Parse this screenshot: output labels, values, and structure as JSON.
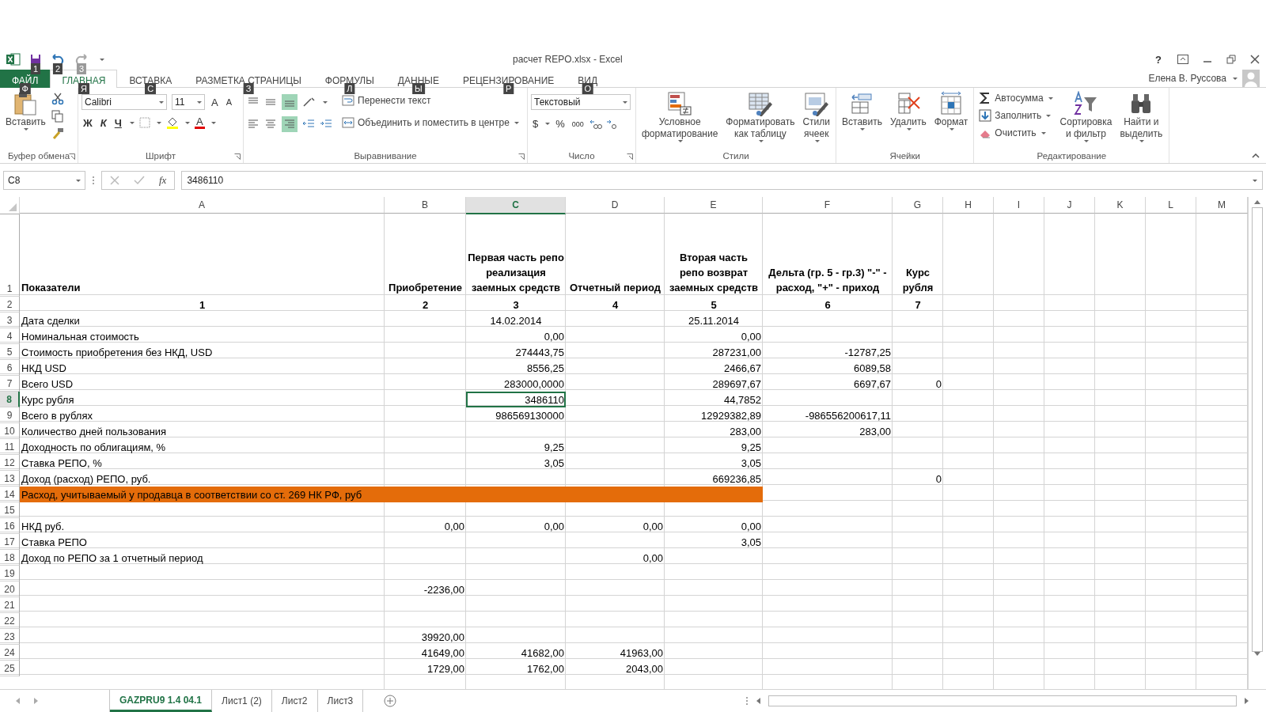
{
  "window": {
    "title": "расчет REPO.xlsx - Excel",
    "user": "Елена В. Руссова",
    "help": "?"
  },
  "quick_access": [
    {
      "kind": "save",
      "keytip": "1"
    },
    {
      "kind": "undo",
      "keytip": "2"
    },
    {
      "kind": "redo",
      "keytip": "3"
    }
  ],
  "tabs": [
    {
      "label": "ФАЙЛ",
      "selected": false,
      "kind": "file",
      "keytip": "Ф"
    },
    {
      "label": "ГЛАВНАЯ",
      "selected": true,
      "kind": "tab",
      "keytip": "Я"
    },
    {
      "label": "ВСТАВКА",
      "selected": false,
      "kind": "tab",
      "keytip": "С"
    },
    {
      "label": "РАЗМЕТКА СТРАНИЦЫ",
      "selected": false,
      "kind": "tab",
      "keytip": "З"
    },
    {
      "label": "ФОРМУЛЫ",
      "selected": false,
      "kind": "tab",
      "keytip": "Л"
    },
    {
      "label": "ДАННЫЕ",
      "selected": false,
      "kind": "tab",
      "keytip": "Ы"
    },
    {
      "label": "РЕЦЕНЗИРОВАНИЕ",
      "selected": false,
      "kind": "tab",
      "keytip": "Р"
    },
    {
      "label": "ВИД",
      "selected": false,
      "kind": "tab",
      "keytip": "О"
    }
  ],
  "ribbon": {
    "clipboard": {
      "label": "Буфер обмена",
      "paste": "Вставить"
    },
    "font": {
      "label": "Шрифт",
      "family": "Calibri",
      "size": "11",
      "grow": "A",
      "shrink": "A",
      "bold": "Ж",
      "italic": "К",
      "underline": "Ч",
      "font_color": "A"
    },
    "alignment": {
      "label": "Выравнивание",
      "wrap": "Перенести текст",
      "merge": "Объединить и поместить в центре"
    },
    "number": {
      "label": "Число",
      "format": "Текстовый",
      "currency": "$",
      "percent": "%",
      "thousands": "000"
    },
    "styles": {
      "label": "Стили",
      "buttons": [
        {
          "kind": "conditional",
          "label": "Условное\nформатирование"
        },
        {
          "kind": "table",
          "label": "Форматировать\nкак таблицу"
        },
        {
          "kind": "cellstyles",
          "label": "Стили\nячеек"
        }
      ]
    },
    "cells": {
      "label": "Ячейки",
      "buttons": [
        {
          "kind": "insert",
          "label": "Вставить"
        },
        {
          "kind": "delete",
          "label": "Удалить"
        },
        {
          "kind": "format",
          "label": "Формат"
        }
      ]
    },
    "editing": {
      "label": "Редактирование",
      "small": [
        {
          "kind": "sum",
          "label": "Автосумма"
        },
        {
          "kind": "fill",
          "label": "Заполнить"
        },
        {
          "kind": "clear",
          "label": "Очистить"
        }
      ],
      "buttons": [
        {
          "kind": "sort",
          "label": "Сортировка\nи фильтр"
        },
        {
          "kind": "find",
          "label": "Найти и\nвыделить"
        }
      ]
    }
  },
  "formula_bar": {
    "name_box": "C8",
    "fx": "fx",
    "value": "3486110"
  },
  "columns": [
    {
      "label": "A",
      "selected": false
    },
    {
      "label": "B",
      "selected": false
    },
    {
      "label": "C",
      "selected": true
    },
    {
      "label": "D",
      "selected": false
    },
    {
      "label": "E",
      "selected": false
    },
    {
      "label": "F",
      "selected": false
    },
    {
      "label": "G",
      "selected": false
    },
    {
      "label": "H",
      "selected": false
    },
    {
      "label": "I",
      "selected": false
    },
    {
      "label": "J",
      "selected": false
    },
    {
      "label": "K",
      "selected": false
    },
    {
      "label": "L",
      "selected": false
    },
    {
      "label": "M",
      "selected": false
    }
  ],
  "rows": [
    {
      "num": "1",
      "selected": false,
      "kind": "header",
      "cells": [
        "Показатели",
        "Приобретение",
        "Первая часть репо реализация заемных средств",
        "Отчетный период",
        "Вторая часть репо возврат заемных средств",
        "Дельта (гр. 5 - гр.3) \"-\" - расход, \"+\" - приход",
        "Курс рубля"
      ]
    },
    {
      "num": "2",
      "selected": false,
      "kind": "index",
      "cells": [
        "1",
        "2",
        "3",
        "4",
        "5",
        "6",
        "7"
      ]
    },
    {
      "num": "3",
      "selected": false,
      "kind": "centered",
      "cells": [
        "Дата сделки",
        "",
        "14.02.2014",
        "",
        "25.11.2014"
      ]
    },
    {
      "num": "4",
      "selected": false,
      "kind": "data",
      "cells": [
        "Номинальная стоимость",
        "",
        "0,00",
        "",
        "0,00"
      ]
    },
    {
      "num": "5",
      "selected": false,
      "kind": "data",
      "cells": [
        "Стоимость приобретения без НКД, USD",
        "",
        "274443,75",
        "",
        "287231,00",
        "-12787,25"
      ]
    },
    {
      "num": "6",
      "selected": false,
      "kind": "data",
      "cells": [
        "НКД USD",
        "",
        "8556,25",
        "",
        "2466,67",
        "6089,58"
      ]
    },
    {
      "num": "7",
      "selected": false,
      "kind": "data",
      "cells": [
        "Всего USD",
        "",
        "283000,0000",
        "",
        "289697,67",
        "6697,67",
        "0"
      ]
    },
    {
      "num": "8",
      "selected": true,
      "kind": "data",
      "cells": [
        "Курс рубля",
        "",
        "3486110",
        "",
        "44,7852"
      ]
    },
    {
      "num": "9",
      "selected": false,
      "kind": "data",
      "cells": [
        "Всего в рублях",
        "",
        "986569130000",
        "",
        "12929382,89",
        "-986556200617,11"
      ]
    },
    {
      "num": "10",
      "selected": false,
      "kind": "data",
      "cells": [
        "Количество дней пользования",
        "",
        "",
        "",
        "283,00",
        "283,00"
      ]
    },
    {
      "num": "11",
      "selected": false,
      "kind": "data",
      "cells": [
        "Доходность по облигациям, %",
        "",
        "9,25",
        "",
        "9,25"
      ]
    },
    {
      "num": "12",
      "selected": false,
      "kind": "data",
      "cells": [
        "Ставка РЕПО, %",
        "",
        "3,05",
        "",
        "3,05"
      ]
    },
    {
      "num": "13",
      "selected": false,
      "kind": "data",
      "cells": [
        "Доход (расход) РЕПО, руб.",
        "",
        "",
        "",
        "669236,85",
        "",
        "0"
      ]
    },
    {
      "num": "14",
      "selected": false,
      "kind": "highlight",
      "cells": [
        "Расход, учитываемый у продавца в соответствии со ст. 269 НК РФ, руб"
      ]
    },
    {
      "num": "15",
      "selected": false,
      "kind": "data",
      "cells": []
    },
    {
      "num": "16",
      "selected": false,
      "kind": "data",
      "cells": [
        "НКД руб.",
        "0,00",
        "0,00",
        "0,00",
        "0,00"
      ]
    },
    {
      "num": "17",
      "selected": false,
      "kind": "data",
      "cells": [
        "Ставка РЕПО",
        "",
        "",
        "",
        "3,05"
      ]
    },
    {
      "num": "18",
      "selected": false,
      "kind": "data",
      "cells": [
        "Доход по РЕПО за 1 отчетный период",
        "",
        "",
        "0,00"
      ]
    },
    {
      "num": "19",
      "selected": false,
      "kind": "data",
      "cells": []
    },
    {
      "num": "20",
      "selected": false,
      "kind": "data",
      "cells": [
        "",
        "-2236,00"
      ]
    },
    {
      "num": "21",
      "selected": false,
      "kind": "data",
      "cells": []
    },
    {
      "num": "22",
      "selected": false,
      "kind": "data",
      "cells": []
    },
    {
      "num": "23",
      "selected": false,
      "kind": "data",
      "cells": [
        "",
        "39920,00"
      ]
    },
    {
      "num": "24",
      "selected": false,
      "kind": "data",
      "cells": [
        "",
        "41649,00",
        "41682,00",
        "41963,00"
      ]
    },
    {
      "num": "25",
      "selected": false,
      "kind": "data",
      "cells": [
        "",
        "1729,00",
        "1762,00",
        "2043,00"
      ]
    }
  ],
  "sheets": [
    {
      "label": "GAZPRU9 1.4 04.1",
      "selected": true
    },
    {
      "label": "Лист1 (2)",
      "selected": false
    },
    {
      "label": "Лист2",
      "selected": false
    },
    {
      "label": "Лист3",
      "selected": false
    }
  ]
}
